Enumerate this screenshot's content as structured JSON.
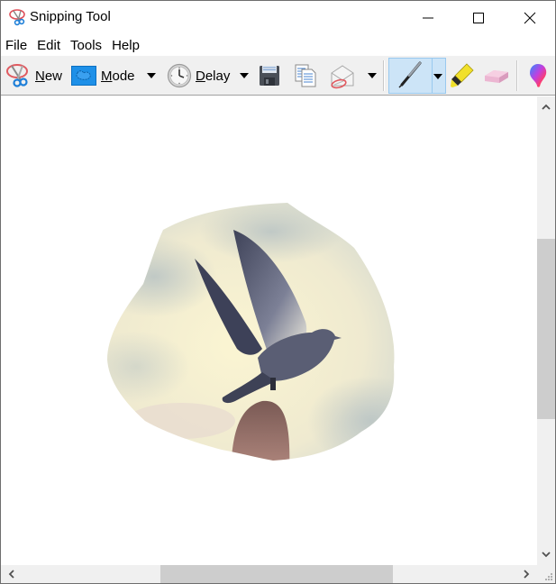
{
  "window": {
    "title": "Snipping Tool",
    "controls": {
      "minimize_icon": "minimize-icon",
      "maximize_icon": "maximize-icon",
      "close_icon": "close-icon"
    }
  },
  "menubar": {
    "items": [
      {
        "label": "File"
      },
      {
        "label": "Edit"
      },
      {
        "label": "Tools"
      },
      {
        "label": "Help"
      }
    ]
  },
  "toolbar": {
    "new": {
      "label_first": "N",
      "label_rest": "ew",
      "icon": "scissors-icon"
    },
    "mode": {
      "label_first": "M",
      "label_rest": "ode",
      "icon": "free-form-snip-icon"
    },
    "delay": {
      "label_first": "D",
      "label_rest": "elay",
      "icon": "clock-icon"
    },
    "save": {
      "icon": "floppy-disk-icon"
    },
    "copy": {
      "icon": "copy-icon"
    },
    "send": {
      "icon": "envelope-icon"
    },
    "pen": {
      "icon": "pen-icon",
      "selected": true
    },
    "highlighter": {
      "icon": "highlighter-icon"
    },
    "eraser": {
      "icon": "eraser-icon"
    },
    "paint3d": {
      "icon": "paint-3d-icon"
    }
  },
  "content": {
    "snip_description": "Free-form snip of a pigeon taking flight from a fingertip against a cloudy sky"
  },
  "colors": {
    "toolbar_bg": "#f0f0f0",
    "selected_tool_bg": "#cce4f7",
    "selected_tool_border": "#99c9ef",
    "scroll_thumb": "#cdcdcd"
  }
}
